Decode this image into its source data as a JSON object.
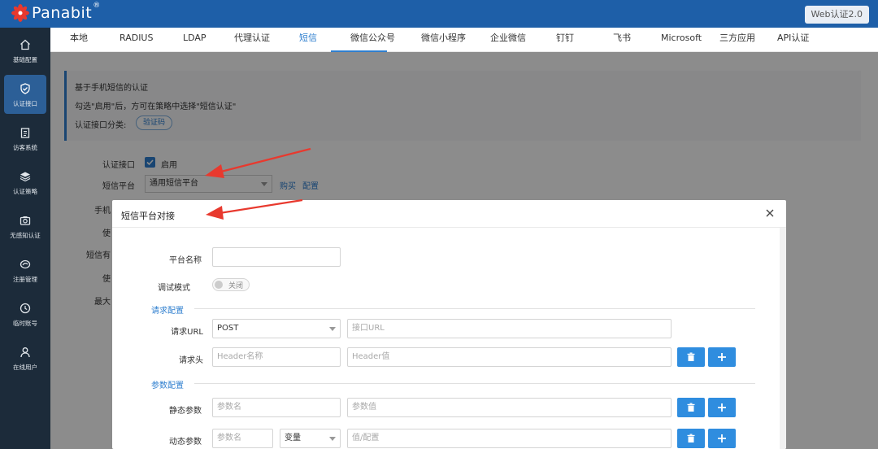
{
  "brand": {
    "name": "Panabit",
    "reg": "®"
  },
  "header": {
    "web_auth_button": "Web认证2.0"
  },
  "sidebar": {
    "items": [
      {
        "label": "基础配置",
        "icon": "home-icon"
      },
      {
        "label": "认证接口",
        "icon": "shield-check-icon",
        "active": true
      },
      {
        "label": "访客系统",
        "icon": "clipboard-icon"
      },
      {
        "label": "认证策略",
        "icon": "layers-icon"
      },
      {
        "label": "无感知认证",
        "icon": "camera-icon"
      },
      {
        "label": "注册管理",
        "icon": "register-icon"
      },
      {
        "label": "临时账号",
        "icon": "clock-icon"
      },
      {
        "label": "在线用户",
        "icon": "user-icon"
      }
    ]
  },
  "tabs": [
    {
      "label": "本地"
    },
    {
      "label": "RADIUS"
    },
    {
      "label": "LDAP"
    },
    {
      "label": "代理认证"
    },
    {
      "label": "短信",
      "active": true
    },
    {
      "label": "微信公众号"
    },
    {
      "label": "微信小程序"
    },
    {
      "label": "企业微信"
    },
    {
      "label": "钉钉"
    },
    {
      "label": "飞书"
    },
    {
      "label": "Microsoft"
    },
    {
      "label": "三方应用"
    },
    {
      "label": "API认证"
    }
  ],
  "info": {
    "line1": "基于手机短信的认证",
    "line2": "勾选\"启用\"后，方可在策略中选择\"短信认证\"",
    "category_label": "认证接口分类:",
    "category_tag": "验证码"
  },
  "form": {
    "auth_interface_label": "认证接口",
    "enable_label": "启用",
    "enabled": true,
    "sms_platform_label": "短信平台",
    "sms_platform_value": "通用短信平台",
    "buy_link": "购买",
    "config_link": "配置",
    "hidden_labels": [
      "手机",
      "使",
      "短信有",
      "使",
      "最大"
    ]
  },
  "modal": {
    "title": "短信平台对接",
    "platform_name_label": "平台名称",
    "platform_name_value": "",
    "debug_mode_label": "调试模式",
    "debug_mode_state": "关闭",
    "request_section": "请求配置",
    "request_url_label": "请求URL",
    "request_method": "POST",
    "request_url_placeholder": "接口URL",
    "request_header_label": "请求头",
    "header_name_placeholder": "Header名称",
    "header_value_placeholder": "Header值",
    "params_section": "参数配置",
    "static_params_label": "静态参数",
    "static_param_name_placeholder": "参数名",
    "static_param_value_placeholder": "参数值",
    "dynamic_params_label": "动态参数",
    "dynamic_param_name_placeholder": "参数名",
    "dynamic_param_type": "变量",
    "dynamic_param_value_placeholder": "值/配置"
  },
  "colors": {
    "topbar": "#1e5fa8",
    "sidebar": "#1c2b3a",
    "accent": "#2f7fcf",
    "button": "#2f8ddf",
    "annotation_arrow": "#e8392e"
  }
}
